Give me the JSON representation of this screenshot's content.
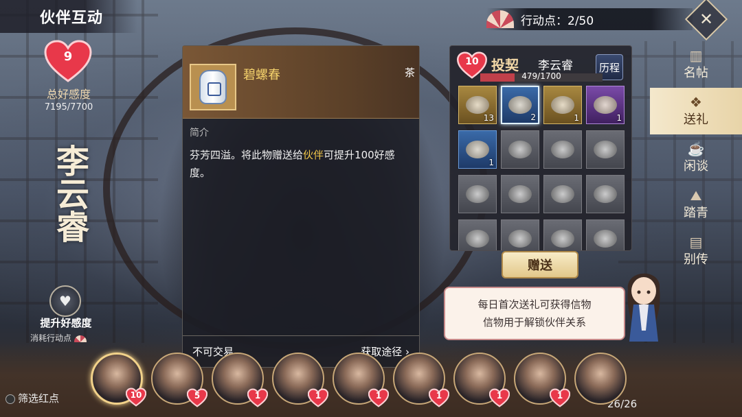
{
  "header": {
    "title": "伙伴互动",
    "action_points_label": "行动点：2/50"
  },
  "affinity": {
    "level": "9",
    "label": "总好感度",
    "value": "7195/7700"
  },
  "character": {
    "name": "李云睿"
  },
  "boost": {
    "label": "提升好感度",
    "sub_label": "消耗行动点"
  },
  "item_detail": {
    "name": "碧螺春",
    "type": "茶",
    "section_title": "简介",
    "desc_before": "芬芳四溢。将此物赠送给",
    "desc_highlight": "伙伴",
    "desc_after": "可提升100好感度。",
    "tradable": "不可交易",
    "source_link": "获取途径 ›"
  },
  "gift_panel": {
    "level": "10",
    "relation": "投契",
    "char_name": "李云睿",
    "history": "历程",
    "progress_text": "479/1700",
    "progress_fraction": 0.2818,
    "items": [
      {
        "style": "gold",
        "count": "13",
        "icon": "fish-dish-icon"
      },
      {
        "style": "blue selected",
        "count": "2",
        "icon": "tea-jar-icon"
      },
      {
        "style": "gold",
        "count": "1",
        "icon": "wine-vase-icon"
      },
      {
        "style": "purple",
        "count": "1",
        "icon": "herb-icon"
      },
      {
        "style": "blue",
        "count": "1",
        "icon": "dish-icon"
      },
      {
        "style": "grey",
        "count": "",
        "icon": "scroll-icon"
      },
      {
        "style": "grey",
        "count": "",
        "icon": "plate-icon"
      },
      {
        "style": "grey",
        "count": "",
        "icon": "dish-icon"
      },
      {
        "style": "grey",
        "count": "",
        "icon": "plate-icon"
      },
      {
        "style": "grey",
        "count": "",
        "icon": "ornament-icon"
      },
      {
        "style": "grey",
        "count": "",
        "icon": "ornament-icon"
      },
      {
        "style": "grey",
        "count": "",
        "icon": "ornament-icon"
      },
      {
        "style": "grey",
        "count": "",
        "icon": "fruit-icon"
      },
      {
        "style": "grey",
        "count": "",
        "icon": "bowl-icon"
      },
      {
        "style": "grey",
        "count": "",
        "icon": "cup-icon"
      },
      {
        "style": "grey",
        "count": "",
        "icon": "scroll-icon"
      }
    ],
    "give_button": "赠送"
  },
  "tip": {
    "line1": "每日首次送礼可获得信物",
    "line2": "信物用于解锁伙伴关系"
  },
  "sidebar": [
    {
      "label": "名帖",
      "icon": "card-icon",
      "active": false
    },
    {
      "label": "送礼",
      "icon": "gift-icon",
      "active": true
    },
    {
      "label": "闲谈",
      "icon": "teacup-icon",
      "active": false
    },
    {
      "label": "踏青",
      "icon": "mountain-icon",
      "active": false
    },
    {
      "label": "别传",
      "icon": "book-icon",
      "active": false
    }
  ],
  "roster": {
    "filter_label": "筛选红点",
    "count": "26/26",
    "portraits": [
      {
        "level": "10",
        "active": true
      },
      {
        "level": "5",
        "active": false
      },
      {
        "level": "1",
        "active": false
      },
      {
        "level": "1",
        "active": false
      },
      {
        "level": "1",
        "active": false
      },
      {
        "level": "1",
        "active": false
      },
      {
        "level": "1",
        "active": false
      },
      {
        "level": "1",
        "active": false
      },
      {
        "level": "",
        "active": false
      }
    ]
  },
  "colors": {
    "heart": "#e8384a",
    "accent_gold": "#f6d36c",
    "highlight": "#f0c64a"
  }
}
